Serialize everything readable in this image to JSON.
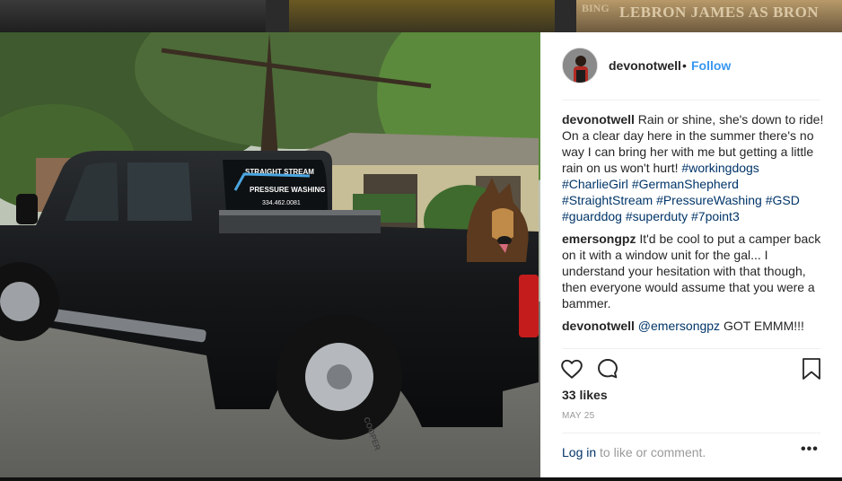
{
  "background": {
    "tile_text_main": "LEBRON JAMES AS BRON",
    "tile_text_small": "BING"
  },
  "photo": {
    "alt": "Black pickup truck with German Shepherd in bed",
    "decal": {
      "line1": "STRAIGHT STREAM",
      "line2": "PRESSURE WASHING",
      "phone": "334.462.0081"
    },
    "tire_text": "COOPER"
  },
  "post": {
    "username": "devonotwell",
    "dot": "•",
    "follow_label": "Follow",
    "caption": {
      "user": "devonotwell",
      "text": "Rain or shine, she's down to ride! On a clear day here in the summer there's no way I can bring her with me but getting a little rain on us won't hurt!",
      "tags": [
        "#workingdogs",
        "#CharlieGirl",
        "#GermanShepherd",
        "#StraightStream",
        "#PressureWashing",
        "#GSD",
        "#guarddog",
        "#superduty",
        "#7point3"
      ]
    },
    "comments": [
      {
        "user": "emersongpz",
        "text": "It'd be cool to put a camper back on it with a window unit for the gal... I understand your hesitation with that though, then everyone would assume that you were a bammer."
      },
      {
        "user": "devonotwell",
        "mention": "@emersongpz",
        "text": "GOT EMMM!!!"
      }
    ],
    "likes": "33 likes",
    "date": "MAY 25",
    "login_link": "Log in",
    "login_rest": "to like or comment.",
    "more": "•••"
  },
  "colors": {
    "link_blue": "#3897f0",
    "tag_blue": "#003569",
    "text": "#262626",
    "muted": "#999999"
  },
  "icons": [
    "heart-icon",
    "comment-icon",
    "bookmark-icon",
    "more-options-icon"
  ]
}
